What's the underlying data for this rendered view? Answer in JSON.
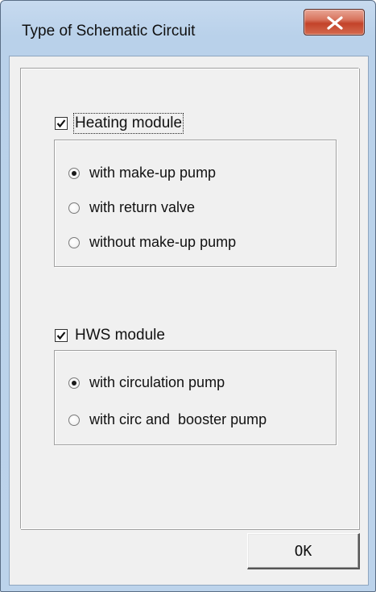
{
  "window": {
    "title": "Type of Schematic Circuit"
  },
  "heating": {
    "checkbox_label": "Heating module",
    "checked": true,
    "options": [
      {
        "label": "with make-up pump",
        "selected": true
      },
      {
        "label": "with return valve",
        "selected": false
      },
      {
        "label": "without make-up pump",
        "selected": false
      }
    ]
  },
  "hws": {
    "checkbox_label": "HWS module",
    "checked": true,
    "options": [
      {
        "label": "with circulation pump",
        "selected": true
      },
      {
        "label": "with circ and  booster pump",
        "selected": false
      }
    ]
  },
  "buttons": {
    "ok_label": "OK"
  },
  "icons": {
    "close": "close-icon",
    "check": "check-icon"
  },
  "colors": {
    "title_bar": "#bcd3eb",
    "close_button": "#c3432a",
    "dialog_face": "#f0f0f0"
  }
}
